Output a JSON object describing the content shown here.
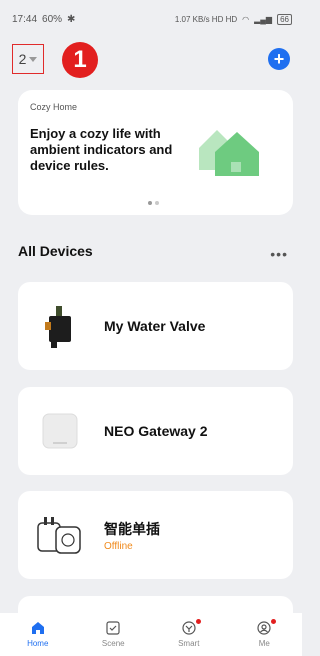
{
  "status_bar": {
    "time": "17:44",
    "left_info": "60%",
    "right_info": "1.07 KB/s HD HD",
    "battery": "66"
  },
  "header": {
    "home_selector": "2",
    "step_number": "1",
    "add_icon": "plus-circle-icon"
  },
  "banner": {
    "brand": "Cozy Home",
    "text": "Enjoy a cozy life with ambient indicators and device rules.",
    "illustration": "green-house-icon",
    "page_index": 1,
    "page_count": 2
  },
  "section": {
    "title": "All Devices",
    "more_icon": "more-dots-icon"
  },
  "devices": [
    {
      "name": "My Water Valve",
      "status": "",
      "icon": "water-valve-icon"
    },
    {
      "name": "NEO Gateway 2",
      "status": "",
      "icon": "gateway-icon"
    },
    {
      "name": "智能单插",
      "status": "Offline",
      "icon": "smart-plug-icon"
    }
  ],
  "tabs": [
    {
      "label": "Home",
      "icon": "home-icon",
      "active": true
    },
    {
      "label": "Scene",
      "icon": "scene-check-icon",
      "active": false
    },
    {
      "label": "Smart",
      "icon": "smart-icon",
      "active": false,
      "badge": true
    },
    {
      "label": "Me",
      "icon": "user-icon",
      "active": false,
      "badge": true
    }
  ],
  "colors": {
    "accent": "#1f6ff0",
    "alert": "#e21f1f",
    "offline": "#f08a1c",
    "background": "#eeeff2"
  }
}
